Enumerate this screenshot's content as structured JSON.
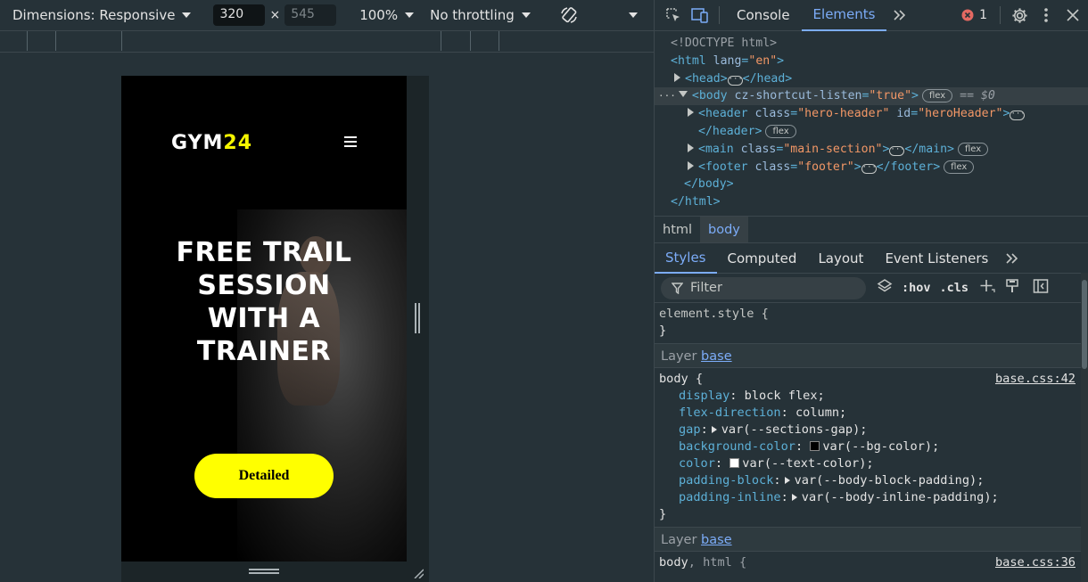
{
  "device_toolbar": {
    "dimensions_label": "Dimensions: Responsive",
    "width": "320",
    "times": "×",
    "height": "545",
    "zoom": "100%",
    "throttling": "No throttling"
  },
  "site": {
    "logo_white": "GYM",
    "logo_yellow": "24",
    "hero_title_lines": [
      "FREE TRAIL",
      "SESSION",
      "WITH A",
      "TRAINER"
    ],
    "cta_label": "Detailed",
    "colors": {
      "accent": "#ffff00",
      "bg": "#000000"
    }
  },
  "devtools": {
    "tabs": [
      "Console",
      "Elements"
    ],
    "active_tab": "Elements",
    "error_count": "1",
    "dom": {
      "doctype": "<!DOCTYPE html>",
      "html_open": "<html",
      "html_attr": "lang",
      "html_val": "\"en\"",
      "head": "<head>",
      "head_close": "</head>",
      "body_open": "<body",
      "body_attr": "cz-shortcut-listen",
      "body_val": "\"true\"",
      "body_badge": "flex",
      "body_eq": "== $0",
      "header_open": "<header",
      "header_attr1": "class",
      "header_val1": "\"hero-header\"",
      "header_attr2": "id",
      "header_val2": "\"heroHeader\"",
      "header_close": "</header>",
      "header_badge": "flex",
      "main_open": "<main",
      "main_attr": "class",
      "main_val": "\"main-section\"",
      "main_close": "</main>",
      "main_badge": "flex",
      "footer_open": "<footer",
      "footer_attr": "class",
      "footer_val": "\"footer\"",
      "footer_close": "</footer>",
      "footer_badge": "flex",
      "body_close": "</body>",
      "html_close": "</html>"
    },
    "breadcrumbs": [
      "html",
      "body"
    ],
    "subtabs": [
      "Styles",
      "Computed",
      "Layout",
      "Event Listeners"
    ],
    "filter_placeholder": "Filter",
    "hov": ":hov",
    "cls": ".cls",
    "styles": {
      "element_style": "element.style {",
      "close_brace": "}",
      "layer_label": "Layer",
      "layer_name": "base",
      "rule1_selector": "body {",
      "rule1_source": "base.css:42",
      "rule1_props": [
        {
          "name": "display",
          "value": "block flex;"
        },
        {
          "name": "flex-direction",
          "value": "column;"
        },
        {
          "name": "gap",
          "value": "var(--sections-gap);"
        },
        {
          "name": "background-color",
          "value": "var(--bg-color);"
        },
        {
          "name": "color",
          "value": "var(--text-color);"
        },
        {
          "name": "padding-block",
          "value": "var(--body-block-padding);"
        },
        {
          "name": "padding-inline",
          "value": "var(--body-inline-padding);"
        }
      ],
      "rule2_selector_a": "body",
      "rule2_selector_b": ", html {",
      "rule2_source": "base.css:36"
    }
  }
}
